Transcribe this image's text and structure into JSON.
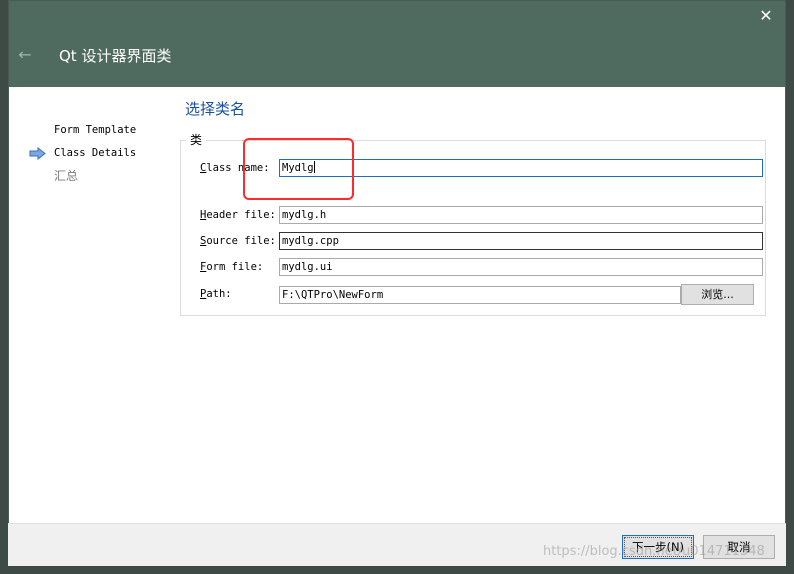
{
  "window": {
    "title": "Qt 设计器界面类",
    "back_icon": "←",
    "close_icon": "✕"
  },
  "steps": [
    {
      "label": "Form Template",
      "state": "done"
    },
    {
      "label": "Class Details",
      "state": "current"
    },
    {
      "label": "汇总",
      "state": "pending"
    }
  ],
  "page": {
    "title": "选择类名",
    "group_title": "类"
  },
  "form": {
    "class_name": {
      "label_pre": "",
      "label_u": "C",
      "label_post": "lass name:",
      "value": "Mydlg"
    },
    "header_file": {
      "label_pre": "",
      "label_u": "H",
      "label_post": "eader file:",
      "value": "mydlg.h"
    },
    "source_file": {
      "label_pre": "",
      "label_u": "S",
      "label_post": "ource file:",
      "value": "mydlg.cpp"
    },
    "form_file": {
      "label_pre": "",
      "label_u": "F",
      "label_post": "orm file:",
      "value": "mydlg.ui"
    },
    "path": {
      "label_pre": "",
      "label_u": "P",
      "label_post": "ath:",
      "value": "F:\\QTPro\\NewForm"
    },
    "browse_label": "浏览..."
  },
  "footer": {
    "next_label": "下一步(N)",
    "cancel_label": "取消"
  },
  "watermark": "https://blog.csdn.net/u014711348",
  "colors": {
    "titlebar": "#4f6b5f",
    "title_blue": "#1d4fa0",
    "annotation_red": "#ff2a2a"
  }
}
